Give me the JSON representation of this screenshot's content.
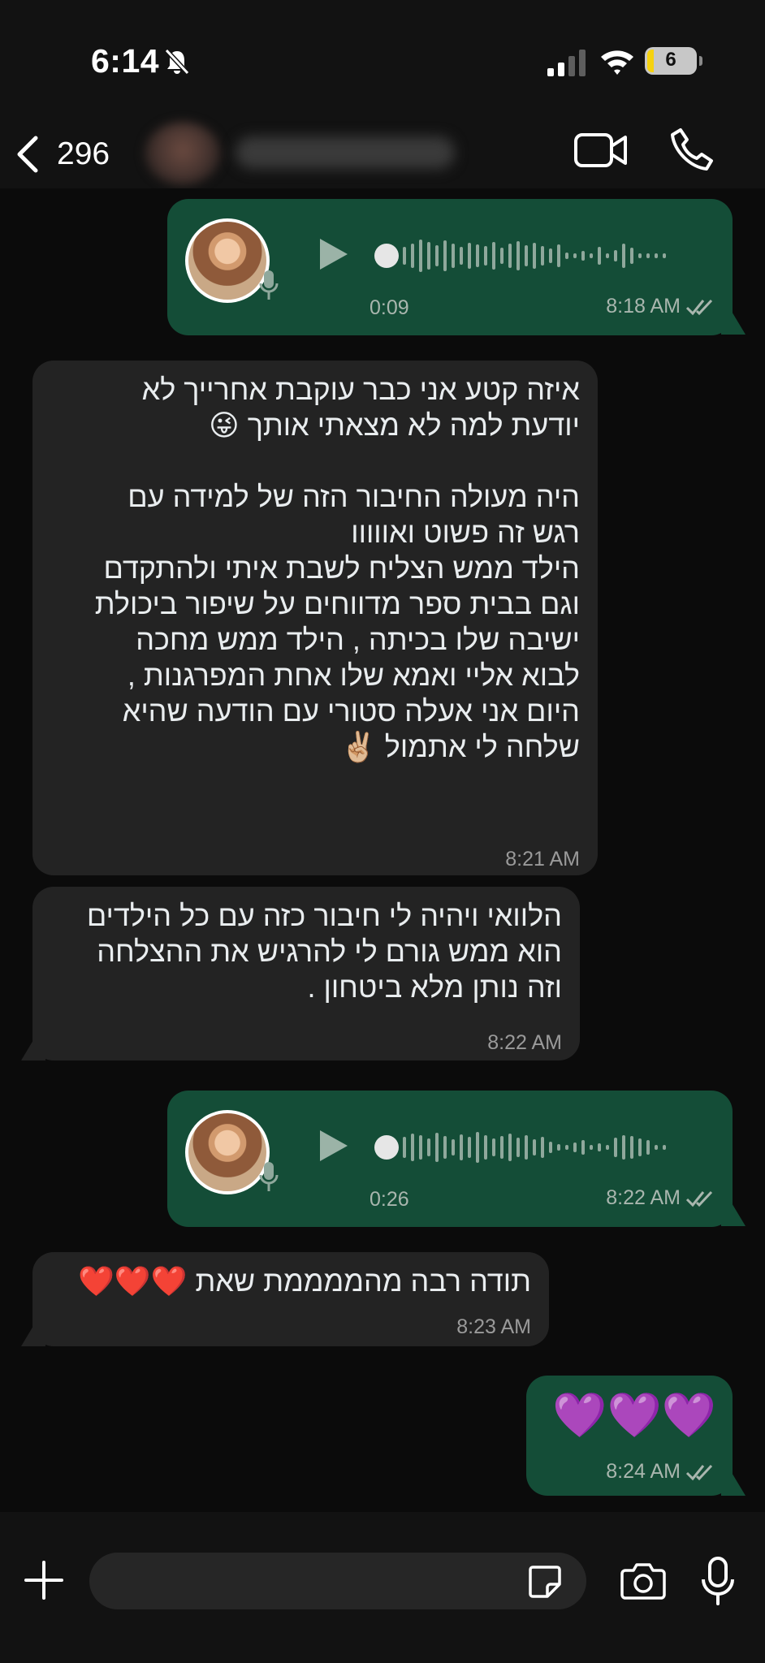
{
  "status_bar": {
    "time": "6:14",
    "battery": "6"
  },
  "header": {
    "back_count": "296"
  },
  "messages": [
    {
      "type": "voice",
      "direction": "out",
      "duration": "0:09",
      "time": "8:18 AM"
    },
    {
      "type": "text",
      "direction": "in",
      "text": "איזה קטע אני כבר עוקבת אחרייך לא\nיודעת למה לא מצאתי אותך 😜\n\nהיה מעולה החיבור הזה של למידה עם\nרגש זה פשוט ואווווו\nהילד ממש הצליח לשבת איתי ולהתקדם\nוגם בבית ספר מדווחים על שיפור ביכולת\nישיבה שלו בכיתה , הילד ממש מחכה\nלבוא אליי ואמא שלו אחת המפרגנות ,\nהיום אני אעלה סטורי עם הודעה שהיא\nשלחה לי אתמול ✌🏼",
      "time": "8:21 AM"
    },
    {
      "type": "text",
      "direction": "in",
      "text": "הלוואי ויהיה לי חיבור כזה עם כל הילדים\nהוא ממש גורם לי להרגיש את ההצלחה\nוזה נותן מלא ביטחון .",
      "time": "8:22 AM"
    },
    {
      "type": "voice",
      "direction": "out",
      "duration": "0:26",
      "time": "8:22 AM"
    },
    {
      "type": "text",
      "direction": "in",
      "text": "תודה רבה מהממממת שאת ❤️❤️❤️",
      "time": "8:23 AM"
    },
    {
      "type": "text",
      "direction": "out",
      "text": "💜💜💜",
      "time": "8:24 AM"
    }
  ],
  "icons": {
    "back": "chevron-left-icon",
    "video": "video-camera-icon",
    "call": "phone-icon",
    "plus": "plus-icon",
    "sticker": "sticker-icon",
    "camera": "camera-icon",
    "mic": "microphone-icon"
  },
  "colors": {
    "outgoing_bubble": "#144d37",
    "incoming_bubble": "#232323",
    "background": "#0b0b0b"
  }
}
